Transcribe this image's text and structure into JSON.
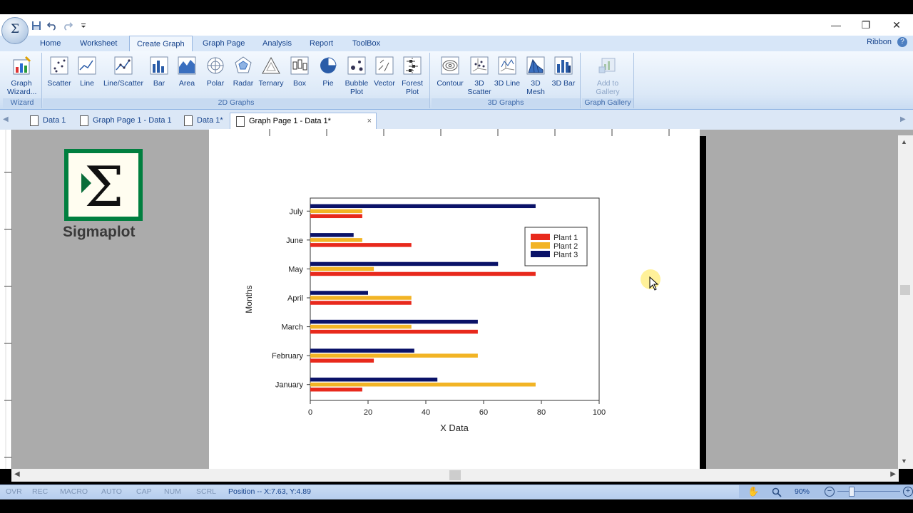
{
  "window": {
    "minimize": "—",
    "restore": "❐",
    "close": "✕"
  },
  "app_orb": "Σ",
  "ribbon_tabs": [
    {
      "label": "Home"
    },
    {
      "label": "Worksheet"
    },
    {
      "label": "Create Graph"
    },
    {
      "label": "Graph Page"
    },
    {
      "label": "Analysis"
    },
    {
      "label": "Report"
    },
    {
      "label": "ToolBox"
    }
  ],
  "ribbon_right_label": "Ribbon",
  "ribbon_groups": {
    "wizard": {
      "label": "Wizard",
      "buttons": [
        {
          "label": "Graph Wizard...",
          "icon": "graph-wizard-icon"
        }
      ]
    },
    "graphs2d": {
      "label": "2D Graphs",
      "buttons": [
        {
          "label": "Scatter",
          "icon": "scatter-icon"
        },
        {
          "label": "Line",
          "icon": "line-icon"
        },
        {
          "label": "Line/Scatter",
          "icon": "line-scatter-icon"
        },
        {
          "label": "Bar",
          "icon": "bar-icon"
        },
        {
          "label": "Area",
          "icon": "area-icon"
        },
        {
          "label": "Polar",
          "icon": "polar-icon"
        },
        {
          "label": "Radar",
          "icon": "radar-icon"
        },
        {
          "label": "Ternary",
          "icon": "ternary-icon"
        },
        {
          "label": "Box",
          "icon": "box-icon"
        },
        {
          "label": "Pie",
          "icon": "pie-icon"
        },
        {
          "label": "Bubble Plot",
          "icon": "bubble-icon"
        },
        {
          "label": "Vector",
          "icon": "vector-icon"
        },
        {
          "label": "Forest Plot",
          "icon": "forest-icon"
        }
      ]
    },
    "graphs3d": {
      "label": "3D Graphs",
      "buttons": [
        {
          "label": "Contour",
          "icon": "contour-icon"
        },
        {
          "label": "3D Scatter",
          "icon": "scatter3d-icon"
        },
        {
          "label": "3D Line",
          "icon": "line3d-icon"
        },
        {
          "label": "3D Mesh",
          "icon": "mesh3d-icon"
        },
        {
          "label": "3D Bar",
          "icon": "bar3d-icon"
        }
      ]
    },
    "gallery": {
      "label": "Graph Gallery",
      "buttons": [
        {
          "label": "Add to Gallery",
          "icon": "add-gallery-icon"
        }
      ]
    }
  },
  "doc_tabs": [
    {
      "label": "Data 1"
    },
    {
      "label": "Graph Page 1 - Data 1"
    },
    {
      "label": "Data 1*"
    },
    {
      "label": "Graph Page 1 - Data 1*",
      "close": "×"
    }
  ],
  "logo": {
    "text": "Sigmaplot",
    "glyph": "Σ"
  },
  "status": {
    "ovr": "OVR",
    "rec": "REC",
    "macro": "MACRO",
    "auto": "AUTO",
    "cap": "CAP",
    "num": "NUM",
    "scrl": "SCRL",
    "position": "Position -- X:7.63, Y:4.89",
    "zoom": "90%"
  },
  "colors": {
    "plant1": "#e8291c",
    "plant2": "#f2b425",
    "plant3": "#0a1268"
  },
  "chart_data": {
    "type": "bar",
    "orientation": "horizontal",
    "categories": [
      "January",
      "February",
      "March",
      "April",
      "May",
      "June",
      "July"
    ],
    "series": [
      {
        "name": "Plant 1",
        "values": [
          18,
          22,
          58,
          35,
          78,
          35,
          18
        ]
      },
      {
        "name": "Plant 2",
        "values": [
          78,
          58,
          35,
          35,
          22,
          18,
          18
        ]
      },
      {
        "name": "Plant 3",
        "values": [
          44,
          36,
          58,
          20,
          65,
          15,
          78
        ]
      }
    ],
    "xlabel": "X Data",
    "ylabel": "Months",
    "xlim": [
      0,
      100
    ],
    "xticks": [
      0,
      20,
      40,
      60,
      80,
      100
    ],
    "grid": false,
    "legend": "top-right"
  }
}
